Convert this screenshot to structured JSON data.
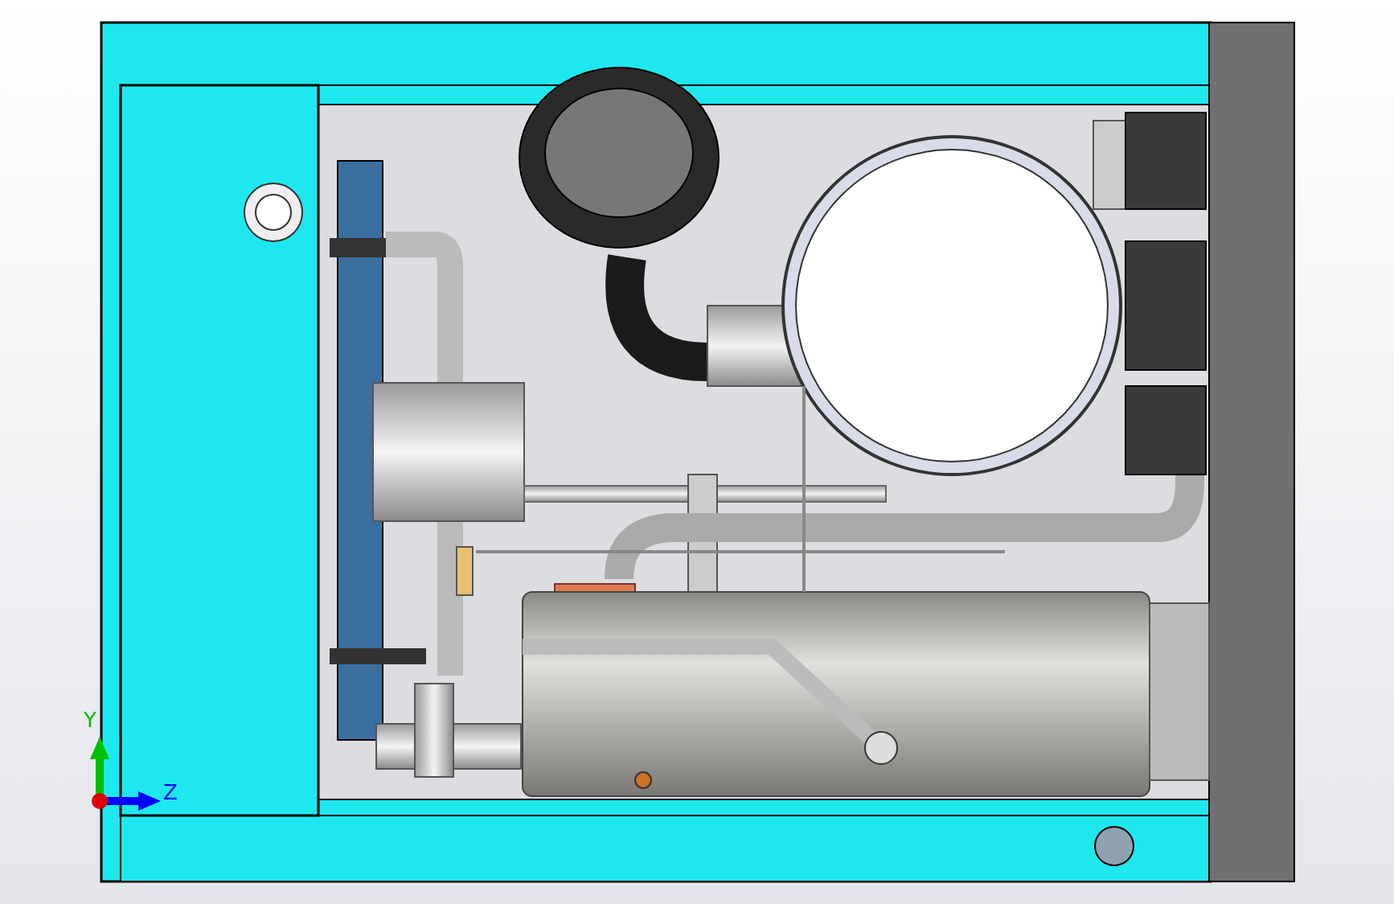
{
  "viewport": {
    "triad": {
      "axes": [
        {
          "label": "Y",
          "kind": "vertical",
          "color": "#00c000"
        },
        {
          "label": "Z",
          "kind": "horizontal",
          "color": "#0000ff"
        }
      ]
    }
  }
}
